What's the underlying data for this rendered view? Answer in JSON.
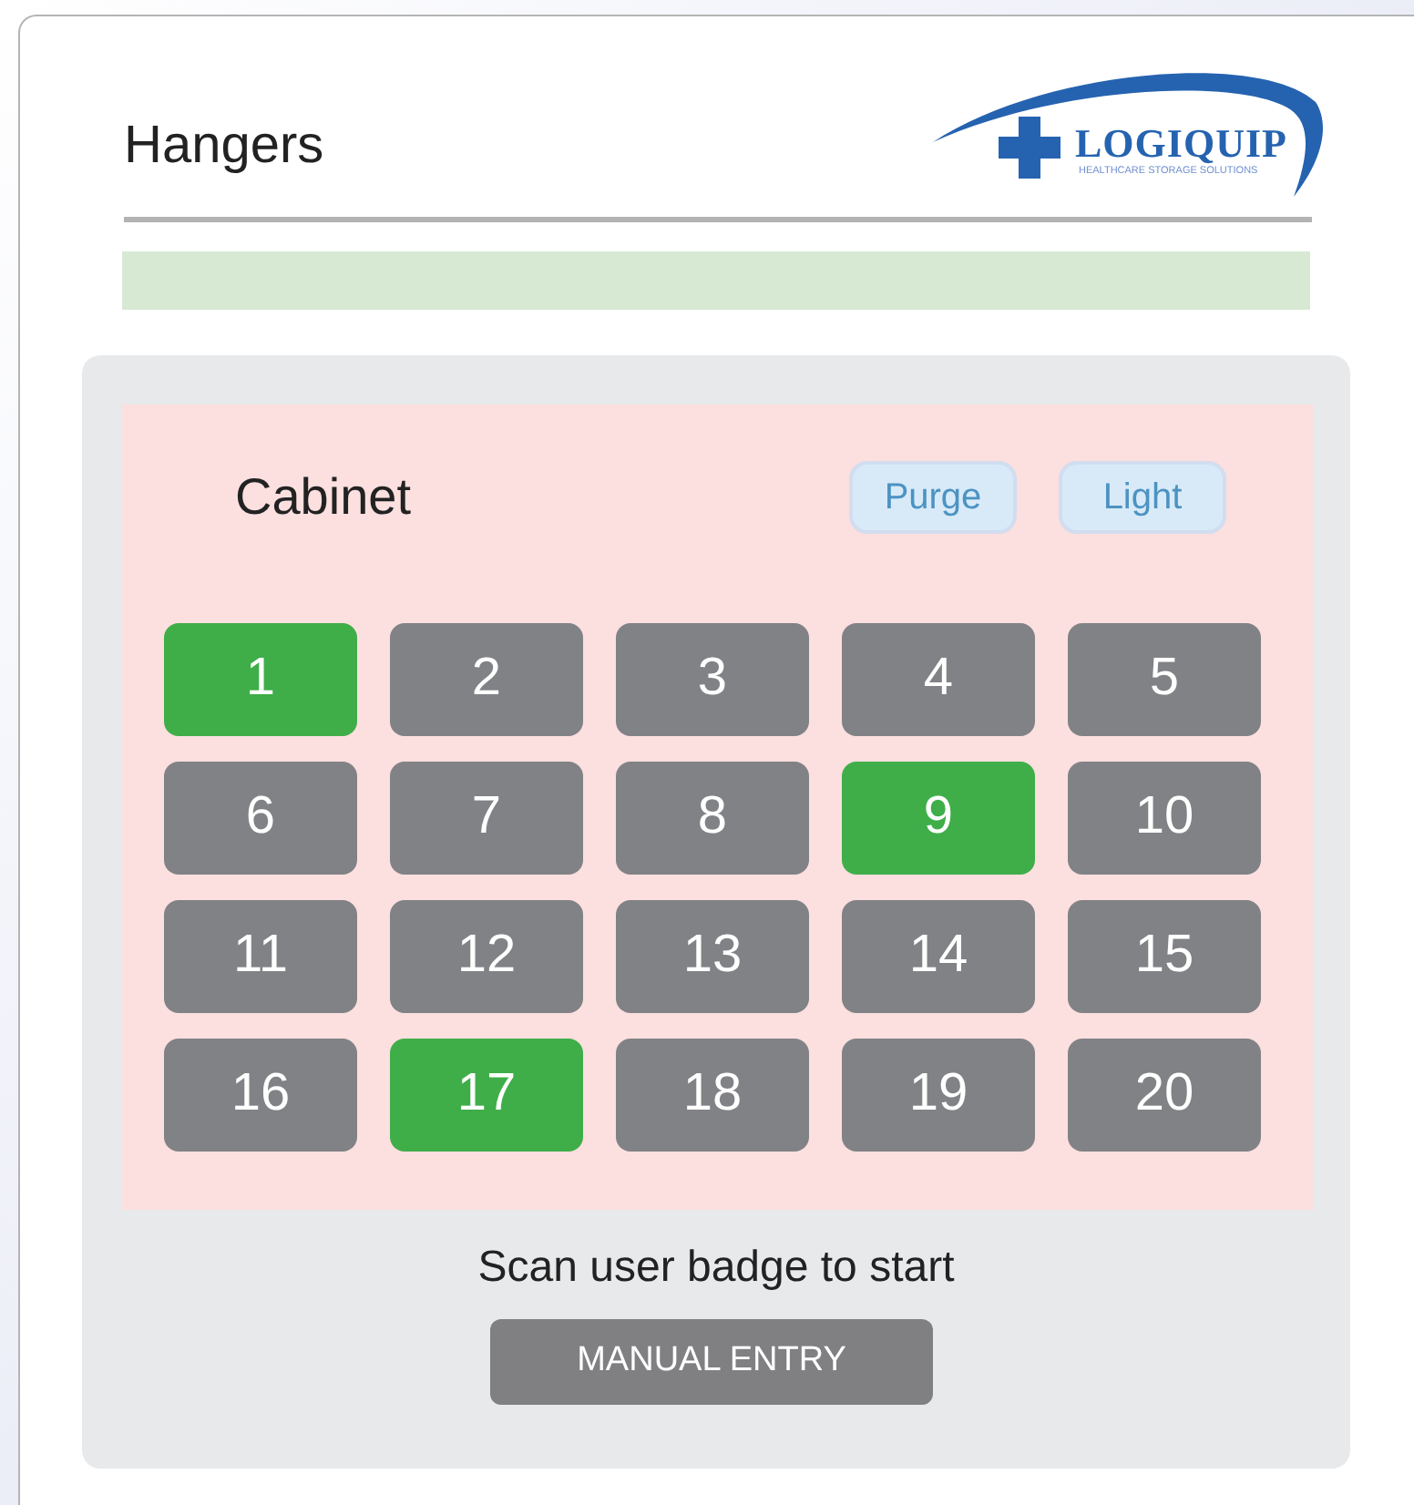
{
  "header": {
    "title": "Hangers",
    "logo": {
      "name": "LOGIQUIP",
      "tagline": "HEALTHCARE STORAGE SOLUTIONS"
    }
  },
  "cabinet": {
    "title": "Cabinet",
    "actions": [
      "Purge",
      "Light"
    ],
    "hangers": [
      {
        "label": "1",
        "selected": true
      },
      {
        "label": "2",
        "selected": false
      },
      {
        "label": "3",
        "selected": false
      },
      {
        "label": "4",
        "selected": false
      },
      {
        "label": "5",
        "selected": false
      },
      {
        "label": "6",
        "selected": false
      },
      {
        "label": "7",
        "selected": false
      },
      {
        "label": "8",
        "selected": false
      },
      {
        "label": "9",
        "selected": true
      },
      {
        "label": "10",
        "selected": false
      },
      {
        "label": "11",
        "selected": false
      },
      {
        "label": "12",
        "selected": false
      },
      {
        "label": "13",
        "selected": false
      },
      {
        "label": "14",
        "selected": false
      },
      {
        "label": "15",
        "selected": false
      },
      {
        "label": "16",
        "selected": false
      },
      {
        "label": "17",
        "selected": true
      },
      {
        "label": "18",
        "selected": false
      },
      {
        "label": "19",
        "selected": false
      },
      {
        "label": "20",
        "selected": false
      }
    ]
  },
  "prompt": "Scan user badge to start",
  "manual_button": "MANUAL ENTRY"
}
